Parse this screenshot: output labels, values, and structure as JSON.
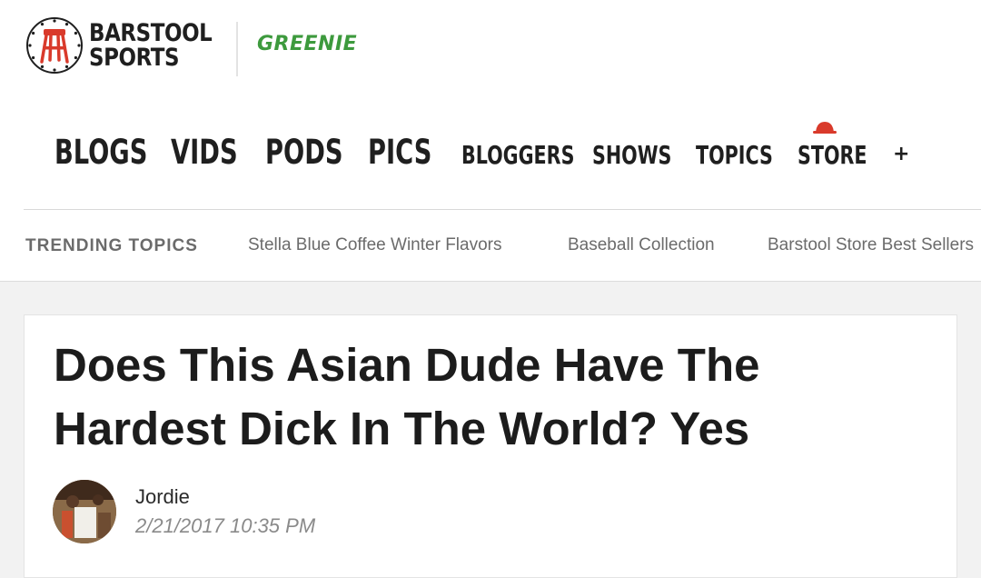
{
  "brand": {
    "logo_line1": "BARSTOOL",
    "logo_line2": "SPORTS",
    "partner": "GREENIE",
    "logo_icon": "barstool-stool-icon",
    "accent_red": "#d93a2b",
    "partner_green": "#3d9a3d"
  },
  "nav": {
    "items": [
      "BLOGS",
      "VIDS",
      "PODS",
      "PICS",
      "BLOGGERS",
      "SHOWS",
      "TOPICS",
      "STORE"
    ],
    "more_label": "+",
    "store_icon": "red-cap-icon"
  },
  "trending": {
    "label": "TRENDING TOPICS",
    "links": [
      "Stella Blue Coffee Winter Flavors",
      "Baseball Collection",
      "Barstool Store Best Sellers"
    ]
  },
  "article": {
    "title": "Does This Asian Dude Have The Hardest Dick In The World? Yes",
    "author": "Jordie",
    "date": "2/21/2017 10:35 PM"
  }
}
